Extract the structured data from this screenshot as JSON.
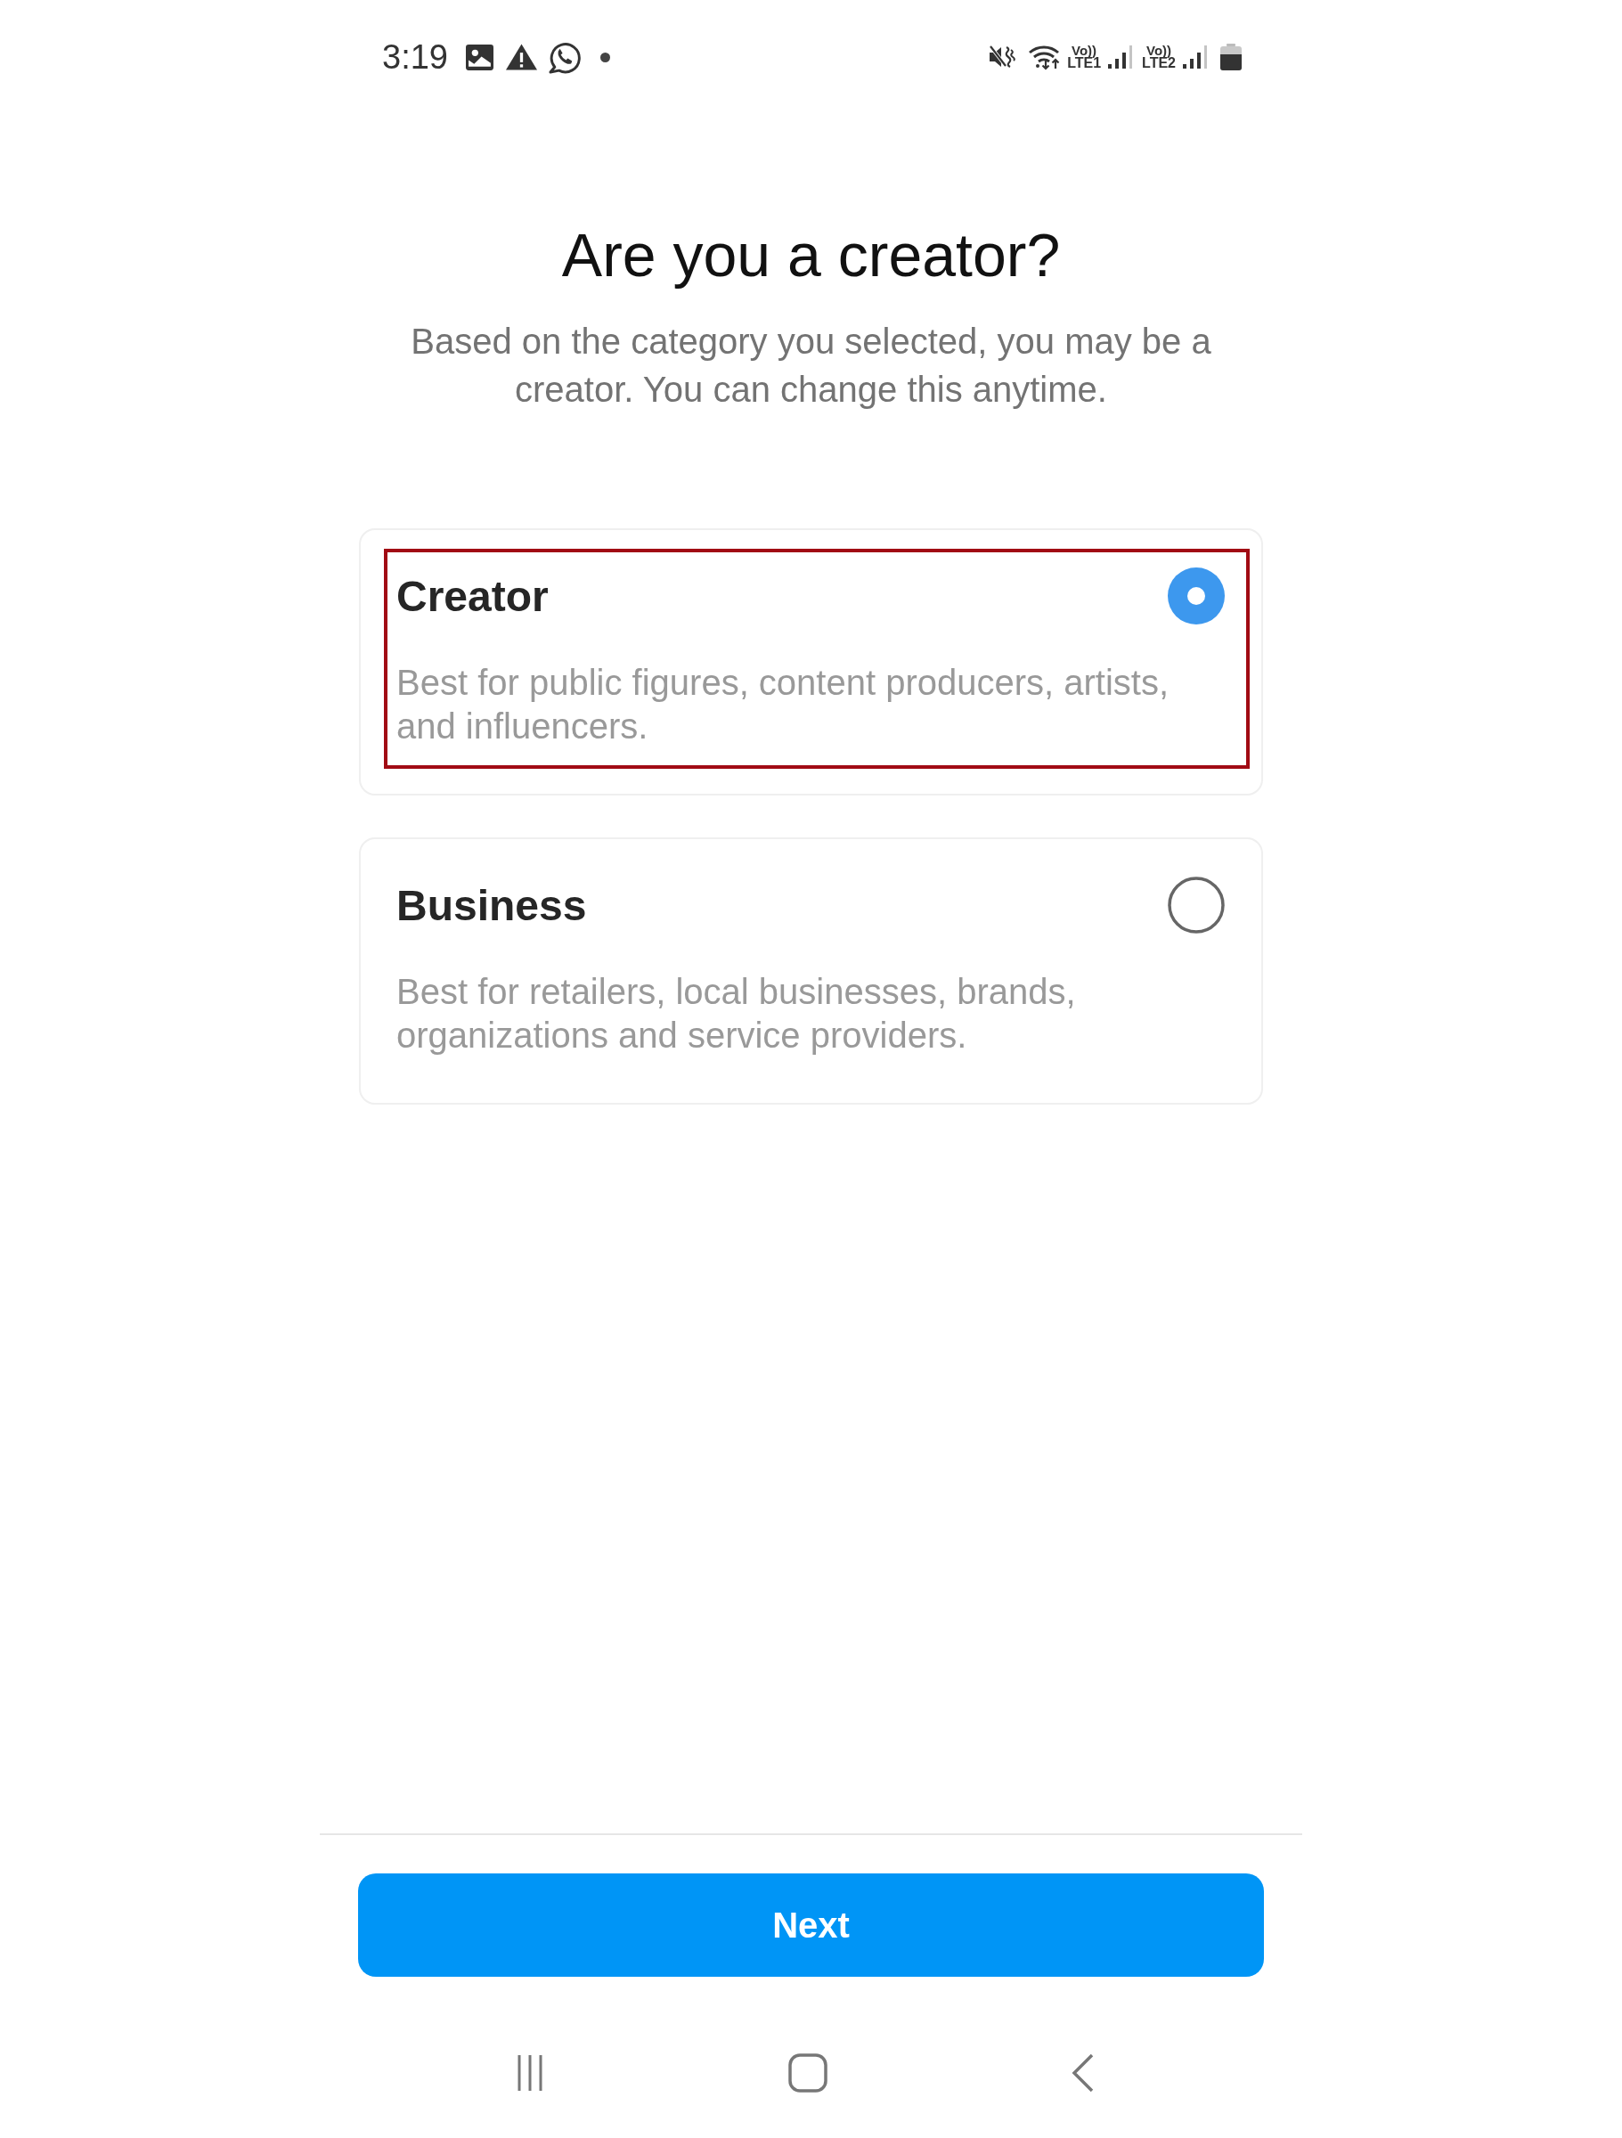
{
  "status_bar": {
    "time": "3:19",
    "sims": [
      {
        "volte": "Vo))",
        "network": "LTE1"
      },
      {
        "volte": "Vo))",
        "network": "LTE2"
      }
    ]
  },
  "header": {
    "title": "Are you a creator?",
    "subtitle": "Based on the category you selected, you may be a creator. You can change this anytime."
  },
  "options": [
    {
      "title": "Creator",
      "description": "Best for public figures, content producers, artists, and influencers.",
      "selected": true,
      "highlighted": true
    },
    {
      "title": "Business",
      "description": "Best for retailers, local businesses, brands, organizations and service providers.",
      "selected": false,
      "highlighted": false
    }
  ],
  "footer": {
    "button": "Next"
  }
}
